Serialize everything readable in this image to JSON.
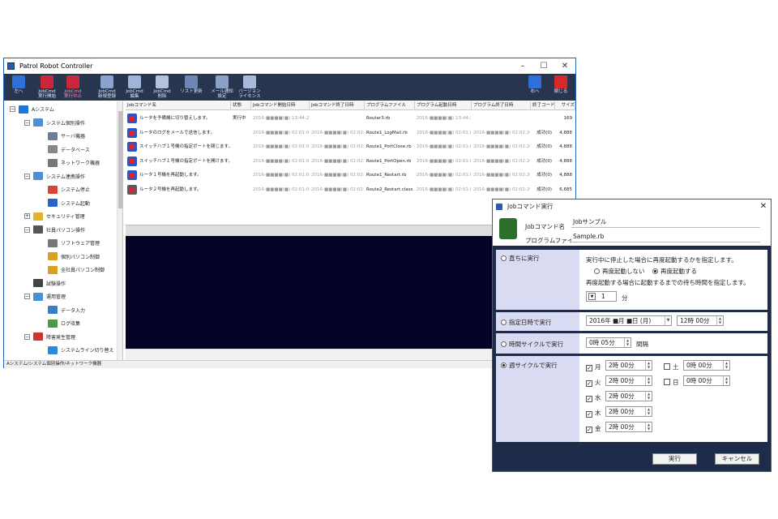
{
  "main_window": {
    "title": "Patrol Robot Controller"
  },
  "toolbar": {
    "items": [
      {
        "label": "左へ"
      },
      {
        "label": "JobCmd\n実行開始"
      },
      {
        "label": "JobCmd\n実行中止"
      },
      {
        "label": "JobCmd\n新規登録"
      },
      {
        "label": "JobCmd\n編集"
      },
      {
        "label": "JobCmd\n削除"
      },
      {
        "label": "リスト更新"
      },
      {
        "label": "メール通知\n設定"
      },
      {
        "label": "バージョン\nライセンス"
      }
    ],
    "right_label": "右へ",
    "close_label": "閉じる"
  },
  "tree": {
    "items": [
      {
        "label": "Aシステム",
        "depth": 0,
        "exp": "−",
        "color": "#1e78d7"
      },
      {
        "label": "システム個別操作",
        "depth": 1,
        "exp": "−",
        "color": "#4a8fd8"
      },
      {
        "label": "サーバ機器",
        "depth": 2,
        "exp": "",
        "color": "#6b7c93"
      },
      {
        "label": "データベース",
        "depth": 2,
        "exp": "",
        "color": "#888"
      },
      {
        "label": "ネットワーク機器",
        "depth": 2,
        "exp": "",
        "color": "#777"
      },
      {
        "label": "システム連携操作",
        "depth": 1,
        "exp": "−",
        "color": "#4a8fd8"
      },
      {
        "label": "システム停止",
        "depth": 2,
        "exp": "",
        "color": "#d9443a"
      },
      {
        "label": "システム起動",
        "depth": 2,
        "exp": "",
        "color": "#2a63c6"
      },
      {
        "label": "セキュリティ管理",
        "depth": 1,
        "exp": "+",
        "color": "#e0b42a"
      },
      {
        "label": "社員パソコン操作",
        "depth": 1,
        "exp": "−",
        "color": "#555"
      },
      {
        "label": "ソフトウェア管理",
        "depth": 2,
        "exp": "",
        "color": "#777"
      },
      {
        "label": "個別パソコン制御",
        "depth": 2,
        "exp": "",
        "color": "#d8a21f"
      },
      {
        "label": "全社員パソコン制御",
        "depth": 2,
        "exp": "",
        "color": "#d8a21f"
      },
      {
        "label": "試験操作",
        "depth": 1,
        "exp": "",
        "color": "#444"
      },
      {
        "label": "運用管理",
        "depth": 1,
        "exp": "−",
        "color": "#4a8fd8"
      },
      {
        "label": "データ入力",
        "depth": 2,
        "exp": "",
        "color": "#3a7dc9"
      },
      {
        "label": "ログ収集",
        "depth": 2,
        "exp": "",
        "color": "#4a9a4a"
      },
      {
        "label": "障害発生管理",
        "depth": 1,
        "exp": "−",
        "color": "#c33"
      },
      {
        "label": "システムライン切り替え",
        "depth": 2,
        "exp": "",
        "color": "#2a8ad8"
      }
    ]
  },
  "status": {
    "path": "Aシステム/システム個別操作/ネットワーク機器"
  },
  "list": {
    "columns": [
      "Jobコマンド名",
      "状態",
      "Jobコマンド開始日時",
      "Jobコマンド終了日時",
      "プログラムファイル",
      "プログラム起動日時",
      "プログラム終了日時",
      "終了コード",
      "サイズ"
    ],
    "rows": [
      [
        "ルータを予備機に切り替えします。",
        "実行中",
        "2016-■■■■(■) 13:44:28",
        "",
        "Router3.rb",
        "2016-■■■■(■) 13:44:28",
        "",
        "",
        "169"
      ],
      [
        "ルータのログをメールで送信します。",
        "",
        "2016-■■■■(■) 02:01:00",
        "2016-■■■■(■) 02:02:20",
        "Route1_LogMail.rb",
        "2016-■■■■(■) 02:01:01",
        "2016-■■■■(■) 02:02:20",
        "成功(0)",
        "4,888"
      ],
      [
        "スイッチハブ１号機の指定ポートを閉じます。",
        "",
        "2016-■■■■(■) 02:01:00",
        "2016-■■■■(■) 02:02:20",
        "Route1_PortClose.rb",
        "2016-■■■■(■) 02:01:01",
        "2016-■■■■(■) 02:02:20",
        "成功(0)",
        "4,888"
      ],
      [
        "スイッチハブ１号機の指定ポートを開けます。",
        "",
        "2016-■■■■(■) 02:01:00",
        "2016-■■■■(■) 02:02:20",
        "Route1_PortOpen.rb",
        "2016-■■■■(■) 02:01:01",
        "2016-■■■■(■) 02:02:20",
        "成功(0)",
        "4,888"
      ],
      [
        "ルータ１号機を再起動します。",
        "",
        "2016-■■■■(■) 02:01:00",
        "2016-■■■■(■) 02:02:20",
        "Route1_Restart.rb",
        "2016-■■■■(■) 02:01:01",
        "2016-■■■■(■) 02:02:20",
        "成功(0)",
        "4,888"
      ],
      [
        "ルータ２号機を再起動します。",
        "",
        "2016-■■■■(■) 02:01:00",
        "2016-■■■■(■) 02:02:20",
        "Route2_Restart.class",
        "2016-■■■■(■) 02:01:01",
        "2016-■■■■(■) 02:02:20",
        "成功(0)",
        "6,685"
      ]
    ]
  },
  "dialog": {
    "title": "Jobコマンド実行",
    "name_label": "Jobコマンド名",
    "name_value": "Jobサンプル",
    "file_label": "プログラムファイル",
    "file_value": "Sample.rb",
    "immediate": {
      "label": "直ちに実行",
      "desc": "実行中に停止した場合に再度起動するかを指定します。",
      "opt_no": "再度起動しない",
      "opt_yes": "再度起動する",
      "wait_desc": "再度起動する場合に起動するまでの待ち時間を指定します。",
      "wait_value": "1",
      "wait_unit": "分"
    },
    "scheduled": {
      "label": "指定日時で実行",
      "date": "2016年 ■月 ■日 (月)",
      "time": "12時 00分"
    },
    "cycle": {
      "label": "時間サイクルで実行",
      "value": "0時 05分",
      "unit": "間隔"
    },
    "weekly": {
      "label": "週サイクルで実行",
      "days": [
        {
          "day": "月",
          "checked": "✓",
          "time": "2時 00分"
        },
        {
          "day": "火",
          "checked": "✓",
          "time": "2時 00分"
        },
        {
          "day": "水",
          "checked": "✓",
          "time": "2時 00分"
        },
        {
          "day": "木",
          "checked": "✓",
          "time": "2時 00分"
        },
        {
          "day": "金",
          "checked": "✓",
          "time": "2時 00分"
        },
        {
          "day": "土",
          "checked": "",
          "time": "0時 00分"
        },
        {
          "day": "日",
          "checked": "",
          "time": "0時 00分"
        }
      ]
    },
    "run_button": "実行",
    "cancel_button": "キャンセル"
  }
}
